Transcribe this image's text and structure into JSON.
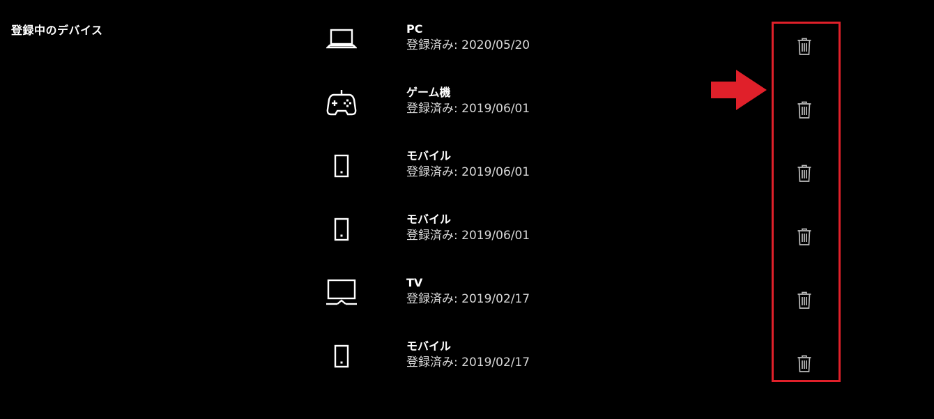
{
  "section": {
    "title": "登録中のデバイス"
  },
  "devices": [
    {
      "name": "PC",
      "registered": "登録済み: 2020/05/20",
      "icon": "laptop-icon"
    },
    {
      "name": "ゲーム機",
      "registered": "登録済み: 2019/06/01",
      "icon": "gamepad-icon"
    },
    {
      "name": "モバイル",
      "registered": "登録済み: 2019/06/01",
      "icon": "mobile-icon"
    },
    {
      "name": "モバイル",
      "registered": "登録済み: 2019/06/01",
      "icon": "mobile-icon"
    },
    {
      "name": "TV",
      "registered": "登録済み: 2019/02/17",
      "icon": "tv-icon"
    },
    {
      "name": "モバイル",
      "registered": "登録済み: 2019/02/17",
      "icon": "mobile-icon"
    }
  ],
  "delete_icon": "trash-icon",
  "colors": {
    "background": "#000000",
    "text": "#ffffff",
    "subtext": "#d8d8d8",
    "trash": "#bdbdbd",
    "highlight": "#e0202a"
  }
}
